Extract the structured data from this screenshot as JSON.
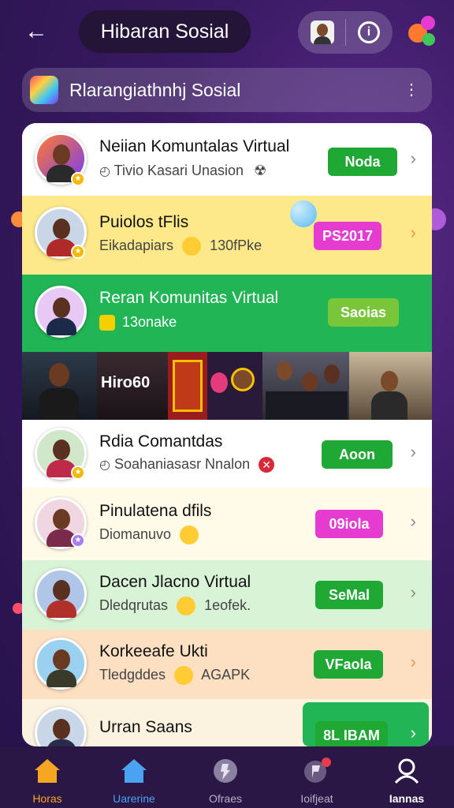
{
  "header": {
    "title": "Hibaran Sosial",
    "info_label": "i"
  },
  "search": {
    "text": "Rlarangiathnhj Sosial"
  },
  "rows": [
    {
      "name": "Neiian Komuntalas Virtual",
      "meta": "Tivio Kasari Unasion",
      "button": "Noda",
      "button_color": "#1fa834",
      "bg": "#ffffff"
    },
    {
      "name": "Puiolos tFlis",
      "meta_a": "Eikadapiars",
      "meta_b": "130fPke",
      "button": "PS2017",
      "button_color": "#e53bd0",
      "bg": "#fde98a"
    },
    {
      "name": "Reran Komunitas Virtual",
      "meta": "13onake",
      "button": "Saoias",
      "button_color": "#79c63a",
      "bg": "#22b556"
    },
    {
      "name": "Rdia Comantdas",
      "meta": "Soahaniasasr Nnalon",
      "button": "Aoon",
      "button_color": "#1fa834",
      "bg": "#ffffff"
    },
    {
      "name": "Pinulatena dfils",
      "meta": "Diomanuvo",
      "button": "09iola",
      "button_color": "#e53bd0",
      "bg": "#fffbe8"
    },
    {
      "name": "Dacen Jlacno Virtual",
      "meta_a": "Dledqrutas",
      "meta_b": "1eofek.",
      "button": "SeMal",
      "button_color": "#1fa834",
      "bg": "#d8f3d6"
    },
    {
      "name": "Korkeeafe Ukti",
      "meta_a": "Tledgddes",
      "meta_b": "AGAPK",
      "button": "VFaola",
      "button_color": "#1fa834",
      "bg": "#fde0c2"
    },
    {
      "name": "Urran Saans",
      "button": "8L IBAM",
      "button_color": "#1fa834",
      "bg": "#fbf3df"
    }
  ],
  "media": {
    "label": "Hiro60"
  },
  "nav": [
    {
      "label": "Horas",
      "color": "#f5a623",
      "icon": "home-icon"
    },
    {
      "label": "Uarerine",
      "color": "#4aa3f0",
      "icon": "home-icon"
    },
    {
      "label": "Ofraes",
      "color": "#b8b0c8",
      "icon": "globe-icon"
    },
    {
      "label": "Ioifjeat",
      "color": "#b8b0c8",
      "icon": "chat-icon"
    },
    {
      "label": "Iannas",
      "color": "#ffffff",
      "icon": "profile-icon"
    }
  ],
  "colors": {
    "background": "#3a1a63",
    "title_pill": "#241438",
    "nav_bar": "#2a1746"
  }
}
